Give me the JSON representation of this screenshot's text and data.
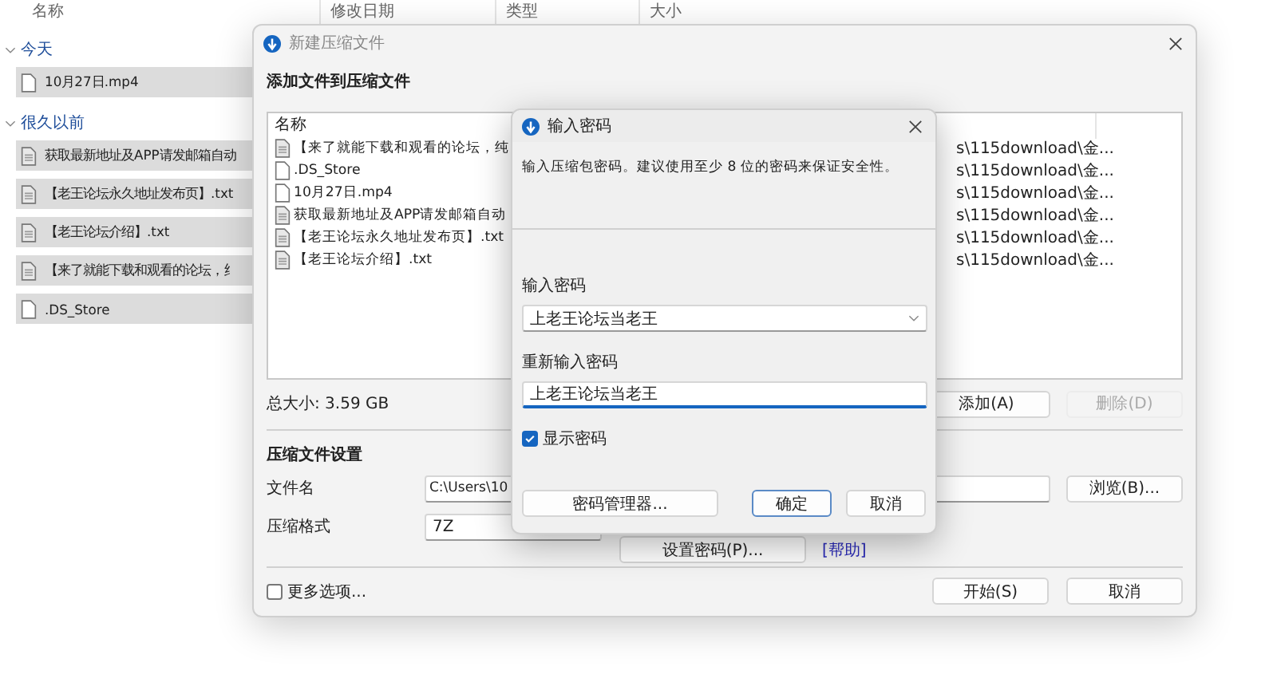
{
  "explorer": {
    "columns": [
      "名称",
      "修改日期",
      "类型",
      "大小"
    ],
    "groups": [
      {
        "label": "今天",
        "expanded": true,
        "items": [
          {
            "name": "10月27日.mp4",
            "kind": "blank"
          }
        ]
      },
      {
        "label": "很久以前",
        "expanded": true,
        "items": [
          {
            "name": "获取最新地址及APP请发邮箱自动",
            "kind": "text"
          },
          {
            "name": "【老王论坛永久地址发布页】.txt",
            "kind": "text"
          },
          {
            "name": "【老王论坛介绍】.txt",
            "kind": "text"
          },
          {
            "name": "【来了就能下载和观看的论坛，纟",
            "kind": "text"
          },
          {
            "name": ".DS_Store",
            "kind": "blank"
          }
        ]
      }
    ]
  },
  "archive_dialog": {
    "title": "新建压缩文件",
    "add_heading": "添加文件到压缩文件",
    "list": {
      "column": "名称",
      "rows": [
        {
          "name": "【来了就能下载和观看的论坛，纯",
          "kind": "text",
          "path": "s\\115download\\金..."
        },
        {
          "name": ".DS_Store",
          "kind": "blank",
          "path": "s\\115download\\金..."
        },
        {
          "name": "10月27日.mp4",
          "kind": "blank",
          "path": "s\\115download\\金..."
        },
        {
          "name": "获取最新地址及APP请发邮箱自动",
          "kind": "text",
          "path": "s\\115download\\金..."
        },
        {
          "name": "【老王论坛永久地址发布页】.txt",
          "kind": "text",
          "path": "s\\115download\\金..."
        },
        {
          "name": "【老王论坛介绍】.txt",
          "kind": "text",
          "path": "s\\115download\\金..."
        }
      ]
    },
    "total_size": "总大小: 3.59 GB",
    "add_button": {
      "label": "添加(A)",
      "disabled": false
    },
    "delete_button": {
      "label": "删除(D)",
      "disabled": true
    },
    "settings_heading": "压缩文件设置",
    "filename_label": "文件名",
    "filename_value": "C:\\Users\\10",
    "browse_button": "浏览(B)...",
    "format_label": "压缩格式",
    "format_value": "7Z",
    "set_password_button": "设置密码(P)...",
    "help_link": "[帮助]",
    "more_options": {
      "label": "更多选项...",
      "checked": false
    },
    "start_button": "开始(S)",
    "cancel_button": "取消"
  },
  "password_dialog": {
    "title": "输入密码",
    "description": "输入压缩包密码。建议使用至少 8 位的密码来保证安全性。",
    "password_label": "输入密码",
    "password_value": "上老王论坛当老王",
    "confirm_label": "重新输入密码",
    "confirm_value": "上老王论坛当老王",
    "show_password": {
      "label": "显示密码",
      "checked": true
    },
    "manager_button": "密码管理器...",
    "ok_button": "确定",
    "cancel_button": "取消"
  }
}
